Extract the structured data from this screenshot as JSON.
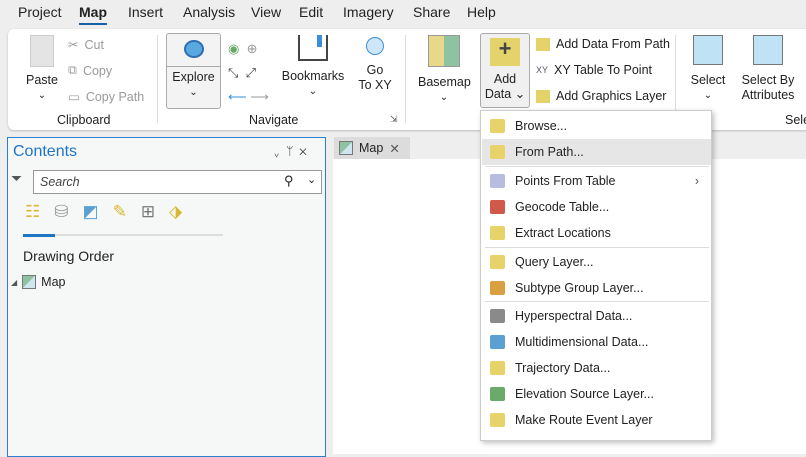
{
  "menu_tabs": [
    "Project",
    "Map",
    "Insert",
    "Analysis",
    "View",
    "Edit",
    "Imagery",
    "Share",
    "Help"
  ],
  "active_tab": "Map",
  "ribbon": {
    "clipboard": {
      "label": "Clipboard",
      "paste": "Paste",
      "cut": "Cut",
      "copy": "Copy",
      "copy_path": "Copy Path"
    },
    "navigate": {
      "label": "Navigate",
      "explore": "Explore",
      "bookmarks": "Bookmarks",
      "go_to_xy_1": "Go",
      "go_to_xy_2": "To XY"
    },
    "layer": {
      "basemap": "Basemap",
      "add_data_1": "Add",
      "add_data_2": "Data",
      "add_data_from_path": "Add Data From Path",
      "xy_table_to_point": "XY Table To Point",
      "add_graphics_layer": "Add Graphics Layer"
    },
    "selection": {
      "label": "Sele",
      "select": "Select",
      "select_by_attributes_1": "Select By",
      "select_by_attributes_2": "Attributes"
    }
  },
  "contents": {
    "title": "Contents",
    "search_placeholder": "Search",
    "drawing_order": "Drawing Order",
    "map_item": "Map"
  },
  "map_tab": {
    "label": "Map"
  },
  "add_data_menu": {
    "items": [
      {
        "label": "Browse...",
        "icon": "add-data-icon",
        "color": "#e8d36a"
      },
      {
        "label": "From Path...",
        "icon": "from-path-icon",
        "color": "#e8d36a",
        "highlighted": true
      },
      {
        "label": "Points From Table",
        "icon": "points-table-icon",
        "color": "#8a8fc8",
        "submenu": true
      },
      {
        "label": "Geocode Table...",
        "icon": "geocode-icon",
        "color": "#d2584a"
      },
      {
        "label": "Extract Locations",
        "icon": "extract-icon",
        "color": "#e8d36a"
      },
      {
        "label": "Query Layer...",
        "icon": "sql-icon",
        "color": "#e8d36a"
      },
      {
        "label": "Subtype Group Layer...",
        "icon": "subtype-icon",
        "color": "#d9a040"
      },
      {
        "label": "Hyperspectral Data...",
        "icon": "hyperspectral-icon",
        "color": "#8a8a8a"
      },
      {
        "label": "Multidimensional Data...",
        "icon": "multidimensional-icon",
        "color": "#5aa0d0"
      },
      {
        "label": "Trajectory Data...",
        "icon": "trajectory-icon",
        "color": "#e8d36a"
      },
      {
        "label": "Elevation Source Layer...",
        "icon": "elevation-icon",
        "color": "#6aaa6a"
      },
      {
        "label": "Make Route Event Layer",
        "icon": "route-event-icon",
        "color": "#e8d36a"
      }
    ]
  }
}
